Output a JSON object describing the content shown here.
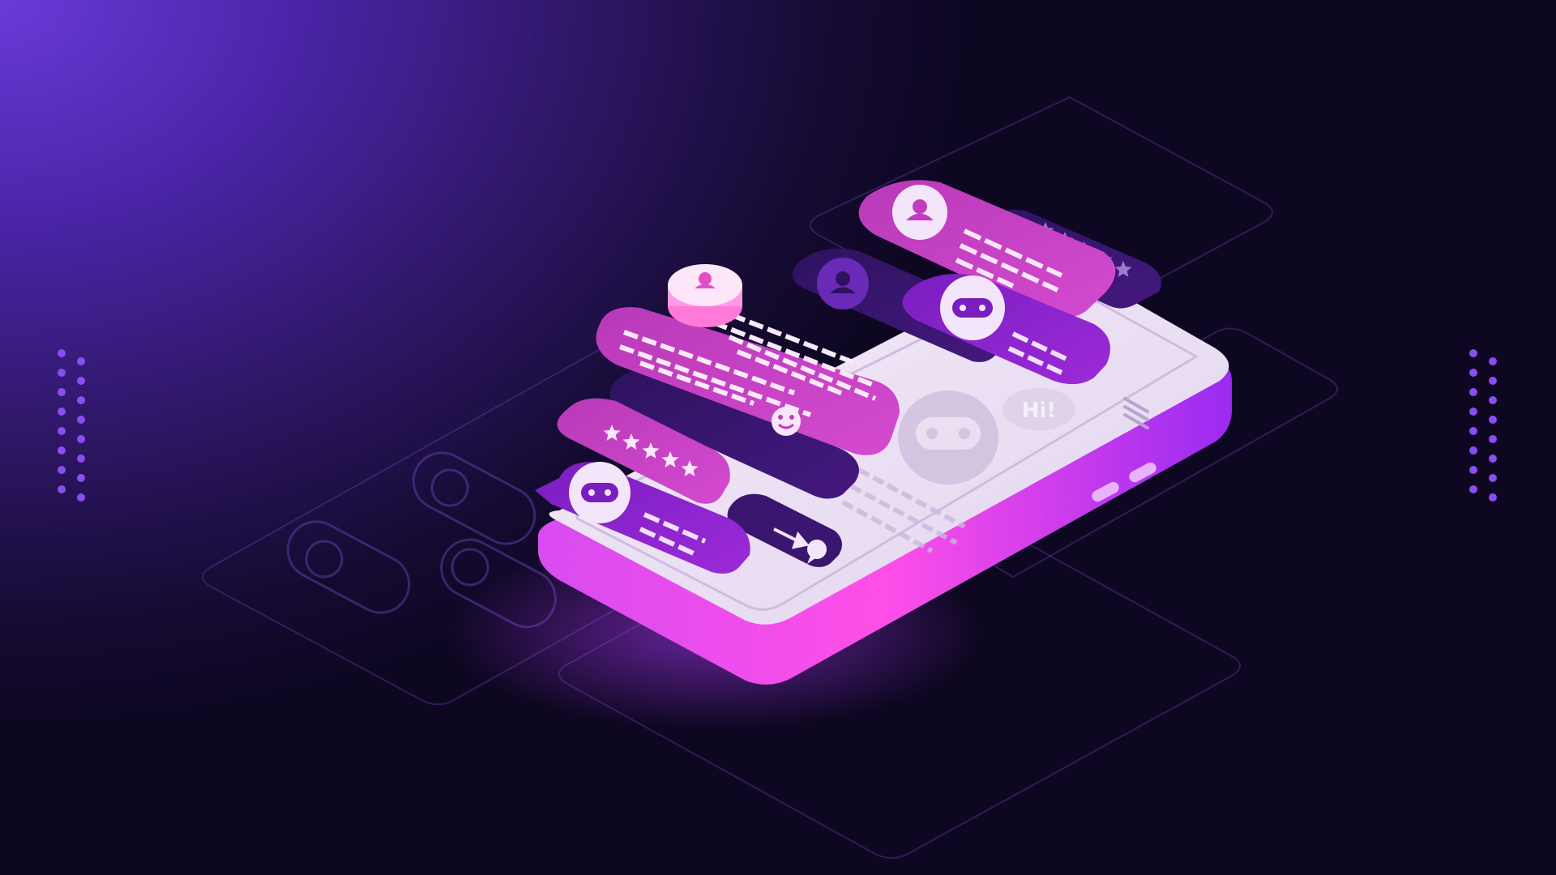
{
  "illustration": {
    "robot_greeting": "Hi!",
    "icons": [
      "user-avatar-icon",
      "robot-icon",
      "star-icon",
      "smiley-icon",
      "send-arrow-icon",
      "chat-bubble-icon",
      "menu-icon",
      "heart-icon",
      "chevron-down-icon"
    ],
    "bubble_ratings": [
      {
        "stars": 5,
        "max": 5
      },
      {
        "stars": 5,
        "max": 5
      }
    ],
    "colors": {
      "background_light": "#6a3ad8",
      "background_dark": "#0e0722",
      "phone_body": "#ece2f3",
      "phone_edge_glow": "#e23bf0",
      "bubble_magenta": "#c23cc0",
      "bubble_purple": "#8a22c8",
      "bubble_dark": "#3a1670",
      "dots": "#8a4ef0"
    }
  }
}
